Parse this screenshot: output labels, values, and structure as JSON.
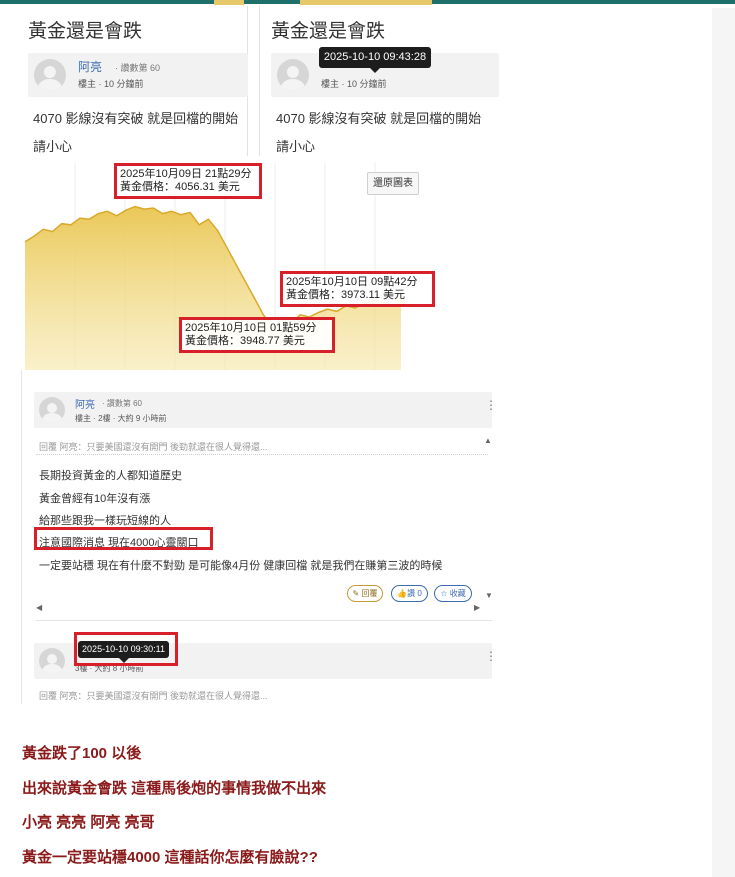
{
  "colors": {
    "accent_bar": "#1f6f6a",
    "annotation_red": "#d8202a",
    "commentary_text": "#8b1a1a",
    "gold_fill": "#e9c54f"
  },
  "post_cards": [
    {
      "title": "黃金還是會跌",
      "author": "阿亮",
      "post_count": "· 讚數第 60",
      "floor": "樓主 ·  10 分鐘前",
      "lines": [
        "4070 影線沒有突破 就是回檔的開始",
        "請小心"
      ]
    },
    {
      "title": "黃金還是會跌",
      "author": "",
      "post_count": "",
      "floor": "樓主 ·  10 分鐘前",
      "tooltip": "2025-10-10 09:43:28",
      "lines": [
        "4070 影線沒有突破 就是回檔的開始",
        "請小心"
      ]
    }
  ],
  "chart": {
    "reset_label": "還原圖表",
    "annotations": [
      {
        "date": "2025年10月09日 21點29分",
        "price": "黃金價格：4056.31 美元"
      },
      {
        "date": "2025年10月10日 09點42分",
        "price": "黃金價格：3973.11 美元"
      },
      {
        "date": "2025年10月10日 01點59分",
        "price": "黃金價格：3948.77 美元"
      }
    ]
  },
  "chart_data": {
    "type": "area",
    "title": "",
    "series": [
      {
        "values": [
          4025,
          4030,
          4036,
          4034,
          4041,
          4040,
          4046,
          4045,
          4050,
          4052,
          4048,
          4053,
          4056.31,
          4054,
          4055,
          4050,
          4052,
          4049,
          4051,
          4040,
          4045,
          4035,
          4020,
          4005,
          3990,
          3975,
          3960,
          3948.77,
          3955,
          3952,
          3960,
          3958,
          3962,
          3965,
          3963,
          3968,
          3966,
          3970,
          3973.11,
          3971,
          3969,
          3972
        ]
      }
    ],
    "grid": true
  },
  "reply_panel": {
    "author": "阿亮",
    "post_count": "· 讚數第 60",
    "floor": "樓主 · 2樓 ·  大約 9 小時前",
    "quote": "回覆 阿亮：只要美國還沒有開門 後勁就還在很人覺得還...",
    "lines": [
      "長期投資黃金的人都知道歷史",
      "黃金曾經有10年沒有漲",
      "給那些跟我一樣玩短線的人",
      "注意國際消息 現在4000心靈關口",
      "一定要站穩 現在有什麼不對勁 是可能像4月份 健康回檔  就是我們在賺第三波的時候"
    ],
    "buttons": {
      "reply": "回覆",
      "like": "讚 0",
      "collect": "收藏"
    },
    "second_floor": "3樓 · 大約 8 小時前",
    "second_tooltip": "2025-10-10 09:30:11",
    "second_quote": "回覆 阿亮：只要美國還沒有開門 後勁就還在很人覺得還..."
  },
  "commentary": [
    "黃金跌了100 以後",
    "出來說黃金會跌 這種馬後炮的事情我做不出來",
    "小亮 亮亮 阿亮 亮哥",
    "黃金一定要站穩4000 這種話你怎麼有臉說??"
  ]
}
